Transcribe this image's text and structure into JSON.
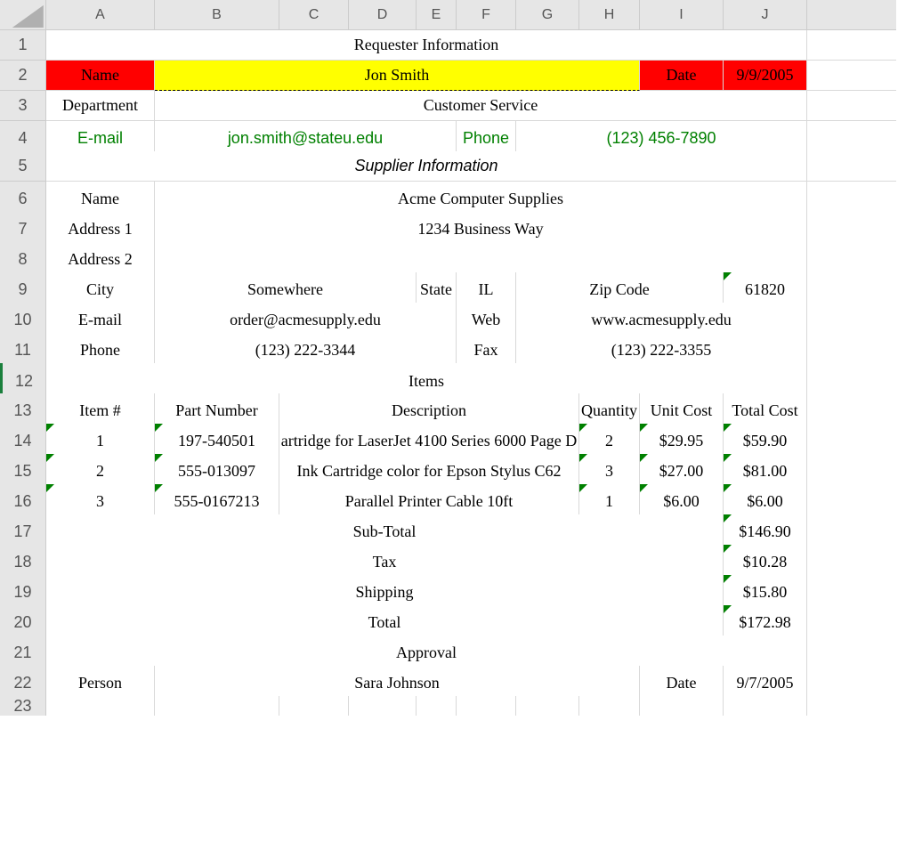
{
  "cols": [
    "A",
    "B",
    "C",
    "D",
    "E",
    "F",
    "G",
    "H",
    "I",
    "J"
  ],
  "rows": [
    "1",
    "2",
    "3",
    "4",
    "5",
    "6",
    "7",
    "8",
    "9",
    "10",
    "11",
    "12",
    "13",
    "14",
    "15",
    "16",
    "17",
    "18",
    "19",
    "20",
    "21",
    "22",
    "23"
  ],
  "requester": {
    "section": "Requester Information",
    "name_label": "Name",
    "name": "Jon Smith",
    "date_label": "Date",
    "date": "9/9/2005",
    "dept_label": "Department",
    "dept": "Customer Service",
    "email_label": "E-mail",
    "email": "jon.smith@stateu.edu",
    "phone_label": "Phone",
    "phone": "(123) 456-7890"
  },
  "supplier": {
    "section": "Supplier Information",
    "name_label": "Name",
    "name": "Acme Computer Supplies",
    "addr1_label": "Address 1",
    "addr1": "1234 Business Way",
    "addr2_label": "Address 2",
    "addr2": "",
    "city_label": "City",
    "city": "Somewhere",
    "state_label": "State",
    "state": "IL",
    "zip_label": "Zip Code",
    "zip": "61820",
    "email_label": "E-mail",
    "email": "order@acmesupply.edu",
    "web_label": "Web",
    "web": "www.acmesupply.edu",
    "phone_label": "Phone",
    "phone": "(123) 222-3344",
    "fax_label": "Fax",
    "fax": "(123) 222-3355"
  },
  "items": {
    "section": "Items",
    "headers": {
      "num": "Item #",
      "part": "Part Number",
      "desc": "Description",
      "qty": "Quantity",
      "unit": "Unit Cost",
      "total": "Total Cost"
    },
    "rows": [
      {
        "num": "1",
        "part": "197-540501",
        "desc": "artridge for LaserJet 4100 Series 6000 Page D",
        "qty": "2",
        "unit": "$29.95",
        "total": "$59.90"
      },
      {
        "num": "2",
        "part": "555-013097",
        "desc": "Ink Cartridge color for Epson Stylus C62",
        "qty": "3",
        "unit": "$27.00",
        "total": "$81.00"
      },
      {
        "num": "3",
        "part": "555-0167213",
        "desc": "Parallel Printer Cable 10ft",
        "qty": "1",
        "unit": "$6.00",
        "total": "$6.00"
      }
    ]
  },
  "totals": {
    "subtotal_label": "Sub-Total",
    "subtotal": "$146.90",
    "tax_label": "Tax",
    "tax": "$10.28",
    "ship_label": "Shipping",
    "ship": "$15.80",
    "total_label": "Total",
    "total": "$172.98"
  },
  "approval": {
    "section": "Approval",
    "person_label": "Person",
    "person": "Sara Johnson",
    "date_label": "Date",
    "date": "9/7/2005"
  }
}
